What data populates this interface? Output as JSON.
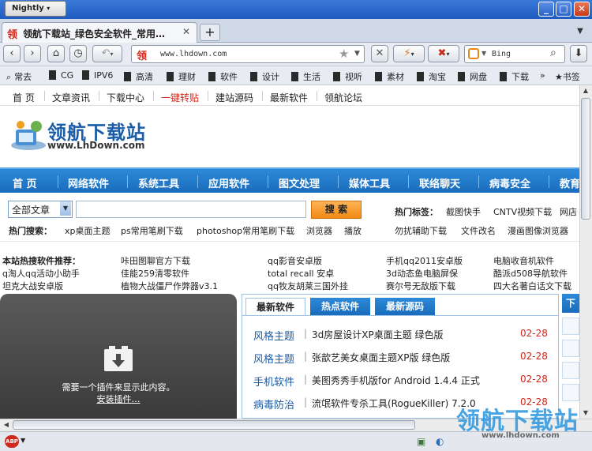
{
  "window": {
    "app_name": "Nightly"
  },
  "tab": {
    "title": "领航下载站_绿色安全软件_常用…",
    "favicon": "领"
  },
  "navbar": {
    "url": "www.lhdown.com",
    "search_engine": "Bing"
  },
  "bookmarks": [
    "常去",
    "CG",
    "IPV6",
    "高清",
    "理财",
    "软件",
    "设计",
    "生活",
    "视听",
    "素材",
    "淘宝",
    "网盘",
    "下载"
  ],
  "bookmarks_more": "书签",
  "topnav": [
    "首 页",
    "文章资讯",
    "下载中心",
    "一键转贴",
    "建站源码",
    "最新软件",
    "领航论坛"
  ],
  "topnav_highlight_color": "#d0281c",
  "logo": {
    "cn": "领航下载站",
    "en": "www.LhDown.com"
  },
  "mainnav": [
    "首 页",
    "网络软件",
    "系统工具",
    "应用软件",
    "图文处理",
    "媒体工具",
    "联络聊天",
    "病毒安全",
    "教育"
  ],
  "search": {
    "category": "全部文章",
    "button": "搜 索",
    "hot_label": "热门搜索：",
    "hot_keywords": [
      "xp桌面主题",
      "ps常用笔刷下载",
      "photoshop常用笔刷下载",
      "浏览器",
      "播放"
    ],
    "tags_label": "热门标签：",
    "tags_row1": [
      "截图快手",
      "CNTV视频下载",
      "网店"
    ],
    "tags_row2": [
      "勿扰辅助下载",
      "文件改名",
      "漫画图像浏览器"
    ]
  },
  "hot_software": {
    "label": "本站热搜软件推荐：",
    "col1": [
      "q淘人qq活动小助手",
      "坦克大战安卓版"
    ],
    "col2": [
      "咔田图聊官方下载",
      "佳能259清零软件",
      "植物大战僵尸作弊器v3.1"
    ],
    "col3": [
      "qq影音安卓版",
      "total recall 安卓",
      "qq牧友胡莱三国外挂"
    ],
    "col4": [
      "手机qq2011安卓版",
      "3d动态鱼电脑屏保",
      "赛尔号无敌版下载"
    ],
    "col5": [
      "电脑收音机软件",
      "酷派d508导航软件",
      "四大名著白话文下载"
    ]
  },
  "plugin": {
    "message": "需要一个插件来显示此内容。",
    "link": "安装插件…"
  },
  "panel_tabs": [
    "最新软件",
    "热点软件",
    "最新源码"
  ],
  "side_tab": "下",
  "news": [
    {
      "category": "风格主题",
      "title": "3d房屋设计XP桌面主题 绿色版",
      "date": "02-28"
    },
    {
      "category": "风格主题",
      "title": "张歆艺美女桌面主题XP版 绿色版",
      "date": "02-28"
    },
    {
      "category": "手机软件",
      "title": "美图秀秀手机版for Android 1.4.4 正式",
      "date": "02-28"
    },
    {
      "category": "病毒防治",
      "title": "流氓软件专杀工具(RogueKiller) 7.2.0",
      "date": "02-28"
    }
  ],
  "watermark": {
    "text": "领航下载站",
    "url": "www.lhdown.com"
  }
}
